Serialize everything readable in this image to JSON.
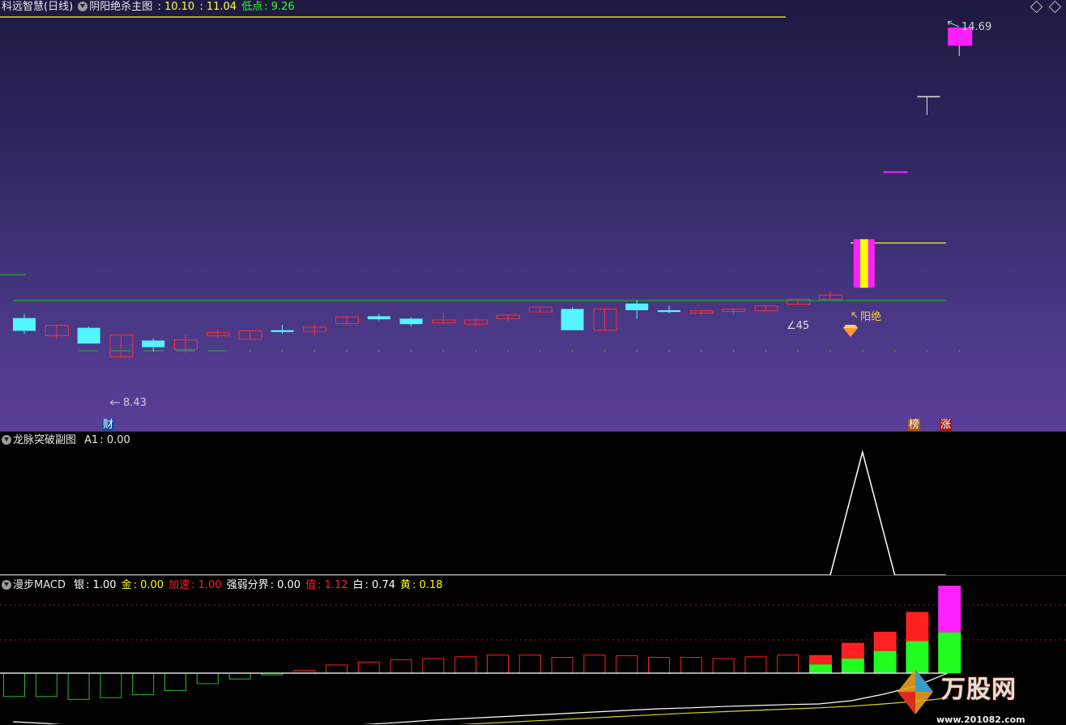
{
  "main": {
    "title": "科远智慧(日线)",
    "indicator": "阴阳绝杀主图",
    "v1": ": 10.10",
    "v2": ": 11.04",
    "low_label": "低点",
    "low_value": ": 9.26",
    "high_label": "14.69",
    "low_marker": "8.43",
    "angle_label": "∠45",
    "yangjue_label": "阳绝",
    "tag_cai": "财",
    "tag_bang": "榜",
    "tag_zhang": "涨"
  },
  "sub1": {
    "title": "龙脉突破副图",
    "a1_label": "A1",
    "a1_value": ": 0.00"
  },
  "sub2": {
    "title": "漫步MACD",
    "items": [
      {
        "label": "银",
        "value": ": 1.00",
        "color": "#ffffff"
      },
      {
        "label": "金",
        "value": ": 0.00",
        "color": "#ffff00"
      },
      {
        "label": "加速",
        "value": ": 1.00",
        "color": "#ff2020"
      },
      {
        "label": "强弱分界",
        "value": ": 0.00",
        "color": "#ffffff"
      },
      {
        "label": "值",
        "value": ": 1.12",
        "color": "#ff2020"
      },
      {
        "label": "白",
        "value": ": 0.74",
        "color": "#ffffff"
      },
      {
        "label": "黄",
        "value": ": 0.18",
        "color": "#ffff00"
      }
    ]
  },
  "watermark": {
    "text": "万股网",
    "url": "www.201082.com"
  },
  "colors": {
    "up": "#ff3030",
    "down": "#54f5ff",
    "bg_top": "#1d1940",
    "bg_bottom": "#5a3f98"
  },
  "candles": [
    {
      "o": 9.9,
      "c": 9.69,
      "h": 9.97,
      "l": 9.64
    },
    {
      "o": 9.61,
      "c": 9.78,
      "h": 9.78,
      "l": 9.54
    },
    {
      "o": 9.74,
      "c": 9.48,
      "h": 9.76,
      "l": 9.48
    },
    {
      "o": 9.26,
      "c": 9.62,
      "h": 9.62,
      "l": 9.26
    },
    {
      "o": 9.53,
      "c": 9.42,
      "h": 9.56,
      "l": 9.35
    },
    {
      "o": 9.38,
      "c": 9.54,
      "h": 9.63,
      "l": 9.33
    },
    {
      "o": 9.61,
      "c": 9.66,
      "h": 9.71,
      "l": 9.56
    },
    {
      "o": 9.55,
      "c": 9.69,
      "h": 9.69,
      "l": 9.55
    },
    {
      "o": 9.7,
      "c": 9.67,
      "h": 9.79,
      "l": 9.64
    },
    {
      "o": 9.68,
      "c": 9.75,
      "h": 9.79,
      "l": 9.61
    },
    {
      "o": 9.81,
      "c": 9.92,
      "h": 9.92,
      "l": 9.77
    },
    {
      "o": 9.93,
      "c": 9.88,
      "h": 9.97,
      "l": 9.86
    },
    {
      "o": 9.89,
      "c": 9.8,
      "h": 9.91,
      "l": 9.76
    },
    {
      "o": 9.82,
      "c": 9.87,
      "h": 9.99,
      "l": 9.8
    },
    {
      "o": 9.8,
      "c": 9.87,
      "h": 9.89,
      "l": 9.77
    },
    {
      "o": 9.89,
      "c": 9.95,
      "h": 9.96,
      "l": 9.85
    },
    {
      "o": 10.0,
      "c": 10.08,
      "h": 10.08,
      "l": 10.0
    },
    {
      "o": 10.05,
      "c": 9.7,
      "h": 10.08,
      "l": 9.7
    },
    {
      "o": 9.7,
      "c": 10.05,
      "h": 10.05,
      "l": 9.7
    },
    {
      "o": 10.14,
      "c": 10.03,
      "h": 10.2,
      "l": 9.88
    },
    {
      "o": 10.03,
      "c": 10.0,
      "h": 10.11,
      "l": 9.98
    },
    {
      "o": 9.98,
      "c": 10.02,
      "h": 10.03,
      "l": 9.96
    },
    {
      "o": 10.01,
      "c": 10.05,
      "h": 10.06,
      "l": 9.95
    },
    {
      "o": 10.02,
      "c": 10.1,
      "h": 10.1,
      "l": 10.02
    },
    {
      "o": 10.13,
      "c": 10.21,
      "h": 10.21,
      "l": 10.13
    },
    {
      "o": 10.21,
      "c": 10.28,
      "h": 10.34,
      "l": 10.21
    },
    {
      "o": 10.4,
      "c": 11.2,
      "h": 11.2,
      "l": 10.4
    },
    {
      "o": 12.32,
      "c": 12.32,
      "h": 12.32,
      "l": 12.32
    },
    {
      "o": 13.55,
      "c": 13.55,
      "h": 13.55,
      "l": 13.25
    },
    {
      "o": 14.39,
      "c": 14.69,
      "h": 14.69,
      "l": 14.22
    }
  ],
  "price_range": {
    "min": 8.4,
    "max": 14.85
  },
  "sub1_peak": {
    "index": 26,
    "value": 1.0
  },
  "macd_hist": [
    -0.4,
    -0.4,
    -0.45,
    -0.42,
    -0.37,
    -0.3,
    -0.18,
    -0.1,
    -0.03,
    0.05,
    0.14,
    0.19,
    0.23,
    0.25,
    0.28,
    0.31,
    0.31,
    0.27,
    0.31,
    0.3,
    0.27,
    0.27,
    0.25,
    0.28,
    0.31,
    0.31,
    0.52,
    0.71,
    1.05,
    1.5
  ],
  "macd_green": [
    0,
    0,
    0,
    0,
    0,
    0,
    0,
    0,
    0,
    0,
    0,
    0,
    0,
    0,
    0,
    0,
    0,
    0,
    0,
    0,
    0,
    0,
    0,
    0,
    0,
    0.15,
    0.25,
    0.38,
    0.55,
    0.7
  ],
  "macd_white": [
    -0.55,
    -0.6,
    -0.68,
    -0.75,
    -0.8,
    -0.85,
    -0.88,
    -0.88,
    -0.83,
    -0.77,
    -0.7,
    -0.63,
    -0.57,
    -0.5,
    -0.45,
    -0.4,
    -0.35,
    -0.3,
    -0.25,
    -0.2,
    -0.15,
    -0.12,
    -0.08,
    -0.05,
    -0.02,
    0.0,
    0.1,
    0.3,
    0.55,
    0.95
  ],
  "macd_yellow": [
    -0.7,
    -0.75,
    -0.8,
    -0.85,
    -0.88,
    -0.9,
    -0.92,
    -0.92,
    -0.9,
    -0.87,
    -0.83,
    -0.78,
    -0.73,
    -0.68,
    -0.63,
    -0.58,
    -0.53,
    -0.48,
    -0.43,
    -0.38,
    -0.33,
    -0.28,
    -0.24,
    -0.2,
    -0.16,
    -0.12,
    -0.07,
    0.0,
    0.08,
    0.18
  ]
}
